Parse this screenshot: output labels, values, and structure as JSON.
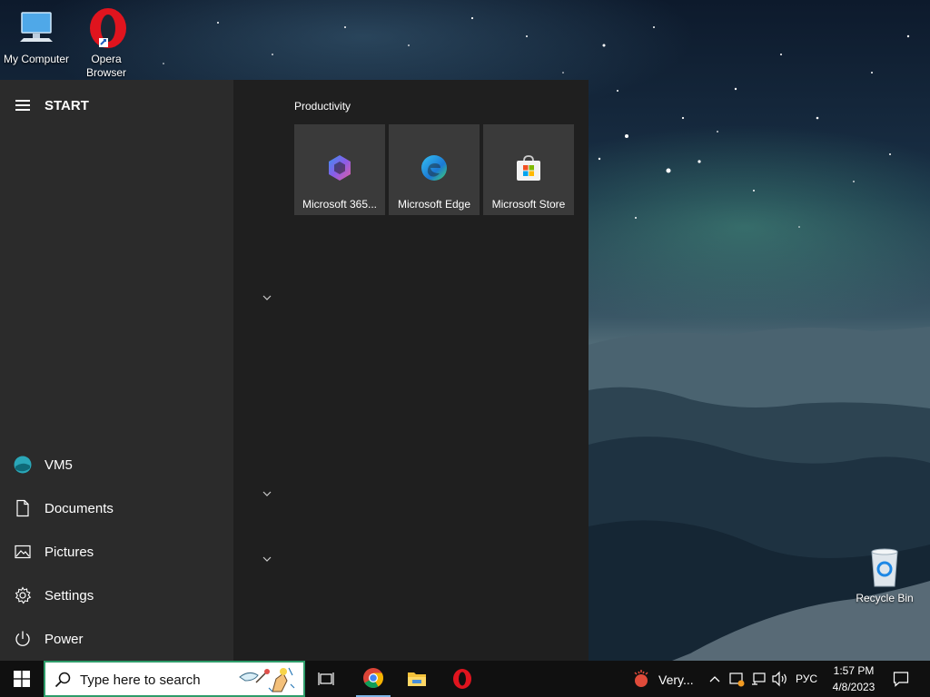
{
  "desktop": {
    "icons": [
      {
        "label": "My Computer",
        "icon": "computer-icon"
      },
      {
        "label": "Opera Browser",
        "icon": "opera-icon"
      },
      {
        "label": "Recycle Bin",
        "icon": "recycle-bin-icon"
      }
    ]
  },
  "start_menu": {
    "title": "START",
    "user": "VM5",
    "items": [
      {
        "label": "Documents",
        "icon": "document-icon"
      },
      {
        "label": "Pictures",
        "icon": "pictures-icon"
      },
      {
        "label": "Settings",
        "icon": "gear-icon"
      },
      {
        "label": "Power",
        "icon": "power-icon"
      }
    ],
    "group_title": "Productivity",
    "tiles": [
      {
        "label": "Microsoft 365...",
        "icon": "microsoft-365-icon"
      },
      {
        "label": "Microsoft Edge",
        "icon": "edge-icon"
      },
      {
        "label": "Microsoft Store",
        "icon": "store-icon"
      }
    ]
  },
  "taskbar": {
    "search_placeholder": "Type here to search",
    "weather_text": "Very...",
    "language": "РУС",
    "time": "1:57 PM",
    "date": "4/8/2023"
  },
  "colors": {
    "accent": "#2e9c6a",
    "start_left_bg": "#2b2b2b",
    "start_right_bg": "#1f1f1f",
    "tile_bg": "#3a3a3a",
    "taskbar_bg": "#101010"
  }
}
